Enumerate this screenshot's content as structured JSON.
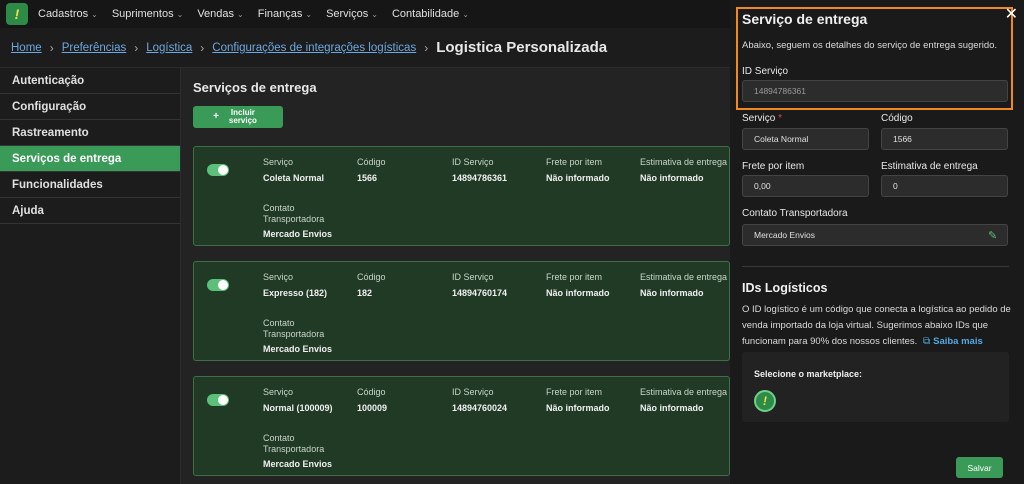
{
  "nav": {
    "items": [
      "Cadastros",
      "Suprimentos",
      "Vendas",
      "Finanças",
      "Serviços",
      "Contabilidade"
    ]
  },
  "breadcrumb": {
    "links": [
      "Home",
      "Preferências",
      "Logística",
      "Configurações de integrações logísticas"
    ],
    "current": "Logistica Personalizada"
  },
  "sidebar": {
    "items": [
      "Autenticação",
      "Configuração",
      "Rastreamento",
      "Serviços de entrega",
      "Funcionalidades",
      "Ajuda"
    ],
    "active_index": 3
  },
  "main": {
    "title": "Serviços de entrega",
    "add_button": "Incluir serviço",
    "labels": {
      "servico": "Serviço",
      "codigo": "Código",
      "id_servico": "ID Serviço",
      "frete": "Frete por item",
      "estimativa": "Estimativa de entrega",
      "contato": "Contato Transportadora"
    },
    "cards": [
      {
        "servico": "Coleta Normal",
        "codigo": "1566",
        "id": "14894786361",
        "frete": "Não informado",
        "estimativa": "Não informado",
        "contato": "Mercado Envios",
        "enabled": true
      },
      {
        "servico": "Expresso (182)",
        "codigo": "182",
        "id": "14894760174",
        "frete": "Não informado",
        "estimativa": "Não informado",
        "contato": "Mercado Envios",
        "enabled": true
      },
      {
        "servico": "Normal (100009)",
        "codigo": "100009",
        "id": "14894760024",
        "frete": "Não informado",
        "estimativa": "Não informado",
        "contato": "Mercado Envios",
        "enabled": true
      }
    ]
  },
  "panel": {
    "title": "Serviço de entrega",
    "description": "Abaixo, seguem os detalhes do serviço de entrega sugerido.",
    "id_label": "ID Serviço",
    "id_value": "14894786361",
    "servico_label": "Serviço",
    "required_mark": "*",
    "servico_value": "Coleta Normal",
    "codigo_label": "Código",
    "codigo_value": "1566",
    "frete_label": "Frete por item",
    "frete_value": "0,00",
    "estimativa_label": "Estimativa de entrega",
    "estimativa_value": "0",
    "contato_label": "Contato Transportadora",
    "contato_value": "Mercado Envios",
    "ids_title": "IDs Logísticos",
    "ids_text": "O ID logístico é um código que conecta a logística ao pedido de venda importado da loja virtual. Sugerimos abaixo IDs que funcionam para 90% dos nossos clientes.",
    "saiba_mais": "Saiba mais",
    "marketplace_label": "Selecione o marketplace:",
    "save_button": "Salvar",
    "close_glyph": "✕"
  },
  "colors": {
    "accent": "#3a9a58",
    "highlight": "#f08a1c",
    "link": "#6ea8e0"
  }
}
